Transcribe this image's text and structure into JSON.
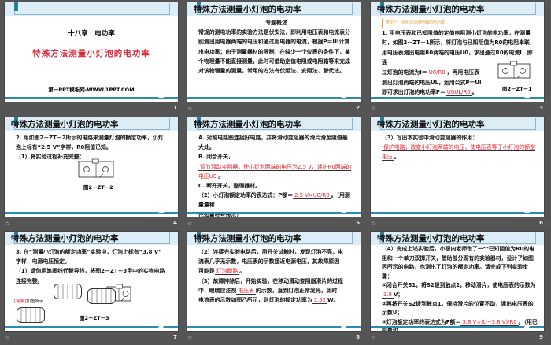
{
  "slide_title": "特殊方法测量小灯泡的电功率",
  "colors": {
    "accent": "#2a8cb0",
    "answer": "#e8202a",
    "header_bg": "#dcedf6"
  },
  "footer_icon": "star-icon",
  "slides": [
    {
      "number": "1",
      "chapter": "十八章　电功率",
      "title": "特殊方法测量小灯泡的电功率",
      "site": "第一PPT模板网-WWW.1PPT.COM"
    },
    {
      "number": "2",
      "lines": [
        [
          {
            "text": "专题概述"
          }
        ],
        [
          {
            "text": "常规的测电功率的实验方法是伏安法，即利用电压表和电流表分"
          }
        ],
        [
          {
            "text": "别测出用电器两端的电压和通过用电器的电流，根据P＝UI计算"
          }
        ],
        [
          {
            "text": "出电功率；由于测量器材的限制，在缺少一个仪表的条件下，某"
          }
        ],
        [
          {
            "text": "个物理量不能直接测量，此时可借助定值电阻或电阻箱等来完成"
          }
        ],
        [
          {
            "text": "对该物理量的测量，常用的方法有伏阻法、安阻法、替代法。"
          }
        ]
      ]
    },
    {
      "number": "3",
      "tag": "类型一　伏阻法测用电器的电功率",
      "figure": "图2－ZT－1",
      "lines": [
        [
          {
            "text": "1. 用电压表和已知阻值的定值电阻测小灯泡的电功率，在测量"
          }
        ],
        [
          {
            "text": "时，如图2－ZT－1所示，将灯泡与已知阻值为R0的电阻串联，"
          }
        ],
        [
          {
            "text": "用电压表测出电阻R0两端的电压U0，求出通过R0的电流I，即通"
          }
        ],
        [
          {
            "text": "过灯泡的电流为I＝"
          },
          {
            "text": "U0/R0",
            "answer": true
          },
          {
            "text": "，再用电压表"
          }
        ],
        [
          {
            "text": "测出灯泡两端的电压UL，运用公式P＝UI"
          }
        ],
        [
          {
            "text": "即可求出灯泡的电功率P＝"
          },
          {
            "text": "U0UL/R0",
            "answer": true
          },
          {
            "text": "。"
          }
        ]
      ]
    },
    {
      "number": "4",
      "figure": "图2－ZT－2",
      "lines": [
        [
          {
            "text": "2. 用如图2－ZT－2所示的电路来测量灯泡的额定功率，小灯"
          }
        ],
        [
          {
            "text": "泡上标有“2.5 V”字样，R0阻值已知。"
          }
        ],
        [
          {
            "text": " "
          }
        ],
        [
          {
            "text": " "
          }
        ],
        [
          {
            "text": " "
          }
        ],
        [
          {
            "text": " "
          }
        ],
        [
          {
            "text": "（1）将实验过程补充完整："
          }
        ]
      ]
    },
    {
      "number": "5",
      "lines": [
        [
          {
            "text": "A. 对照电路图连接好电路，并将滑动变阻器的滑片滑至阻值最"
          }
        ],
        [
          {
            "text": "大处。"
          }
        ],
        [
          {
            "text": "B. 闭合开关，"
          }
        ],
        [
          {
            "text": "调节滑动变阻器，使小灯泡两端的电压为2.5 V，读出R0两端的电压U0",
            "answer": true
          },
          {
            "text": "。"
          }
        ],
        [
          {
            "text": "C. 断开开关，整理器材。"
          }
        ],
        [
          {
            "text": "（2）小灯泡额定功率的表达式：P额＝"
          },
          {
            "text": "2.5 V×U0/R0",
            "answer": true
          },
          {
            "text": "。（用测量量和"
          }
        ],
        [
          {
            "text": "已知量符号表示）"
          }
        ]
      ]
    },
    {
      "number": "6",
      "lines": [
        [
          {
            "text": " "
          }
        ],
        [
          {
            "text": "（3）写出本实验中滑动变阻器的作用："
          }
        ],
        [
          {
            "text": "保护电路；改变小灯泡两端的电压，使电压表等于小灯泡的额定电压",
            "answer": true
          },
          {
            "text": "。"
          }
        ]
      ]
    },
    {
      "number": "7",
      "figure": "图2－ZT－3",
      "answer_label": "[答案]",
      "answer_text": "如图所示",
      "lines": [
        [
          {
            "text": "3. 在“测量小灯泡的额定功率”实验中，灯泡上标有“3.8 V”"
          }
        ],
        [
          {
            "text": "字样，电源电压恒定。"
          }
        ],
        [
          {
            "text": "（1）请你用笔画线代替导线，将图2－ZT－3甲中的实物电路"
          }
        ],
        [
          {
            "text": "连接完整。"
          }
        ]
      ]
    },
    {
      "number": "8",
      "lines": [
        [
          {
            "text": " "
          }
        ],
        [
          {
            "text": "（2）连接完实验电路后，用开关试触时，发现灯泡不亮，电"
          }
        ],
        [
          {
            "text": "流表几乎无示数，电压表的示数接近电源电压，其故障原因"
          }
        ],
        [
          {
            "text": "可能是"
          },
          {
            "text": "灯泡断路",
            "answer": true
          },
          {
            "text": "。"
          }
        ],
        [
          {
            "text": "（3）故障排除后，开始实验，在移动滑动变阻器滑片的过程"
          }
        ],
        [
          {
            "text": "中，眼睛应注视"
          },
          {
            "text": "电压表",
            "answer": true
          },
          {
            "text": "的示数，直到灯泡正常发光，此时"
          }
        ],
        [
          {
            "text": "电流表的示数如图乙所示，则灯泡的额定功率为"
          },
          {
            "text": "1.52",
            "answer": true
          },
          {
            "text": "W。"
          }
        ]
      ]
    },
    {
      "number": "9",
      "lines": [
        [
          {
            "text": "（4）完成上述实验后，小聪向老师借了一个已知阻值为R0的电"
          }
        ],
        [
          {
            "text": "阻和一个单刀双掷开关，借助部分现有的实验器材，设计了如图"
          }
        ],
        [
          {
            "text": "丙所示的电路，也测出了灯泡的额定功率。请完成下列实验步骤："
          }
        ],
        [
          {
            "text": "①闭合开关S1，将S2拨到触点2，移动滑片，使电压表的示数为"
          }
        ],
        [
          {
            "text": "3.8",
            "answer": true
          },
          {
            "text": "V；"
          }
        ],
        [
          {
            "text": "②再将开关S2拨到触点1，保持滑片的位置不动，读出电压表的"
          }
        ],
        [
          {
            "text": "示数U；"
          }
        ],
        [
          {
            "text": "③灯泡额定功率的表达式为P额＝"
          },
          {
            "text": "3.8 V×(U−3.8 V)/R0",
            "answer": true
          },
          {
            "text": "。（用已知量和"
          }
        ],
        [
          {
            "text": "测量量符号表示）"
          }
        ]
      ]
    }
  ]
}
